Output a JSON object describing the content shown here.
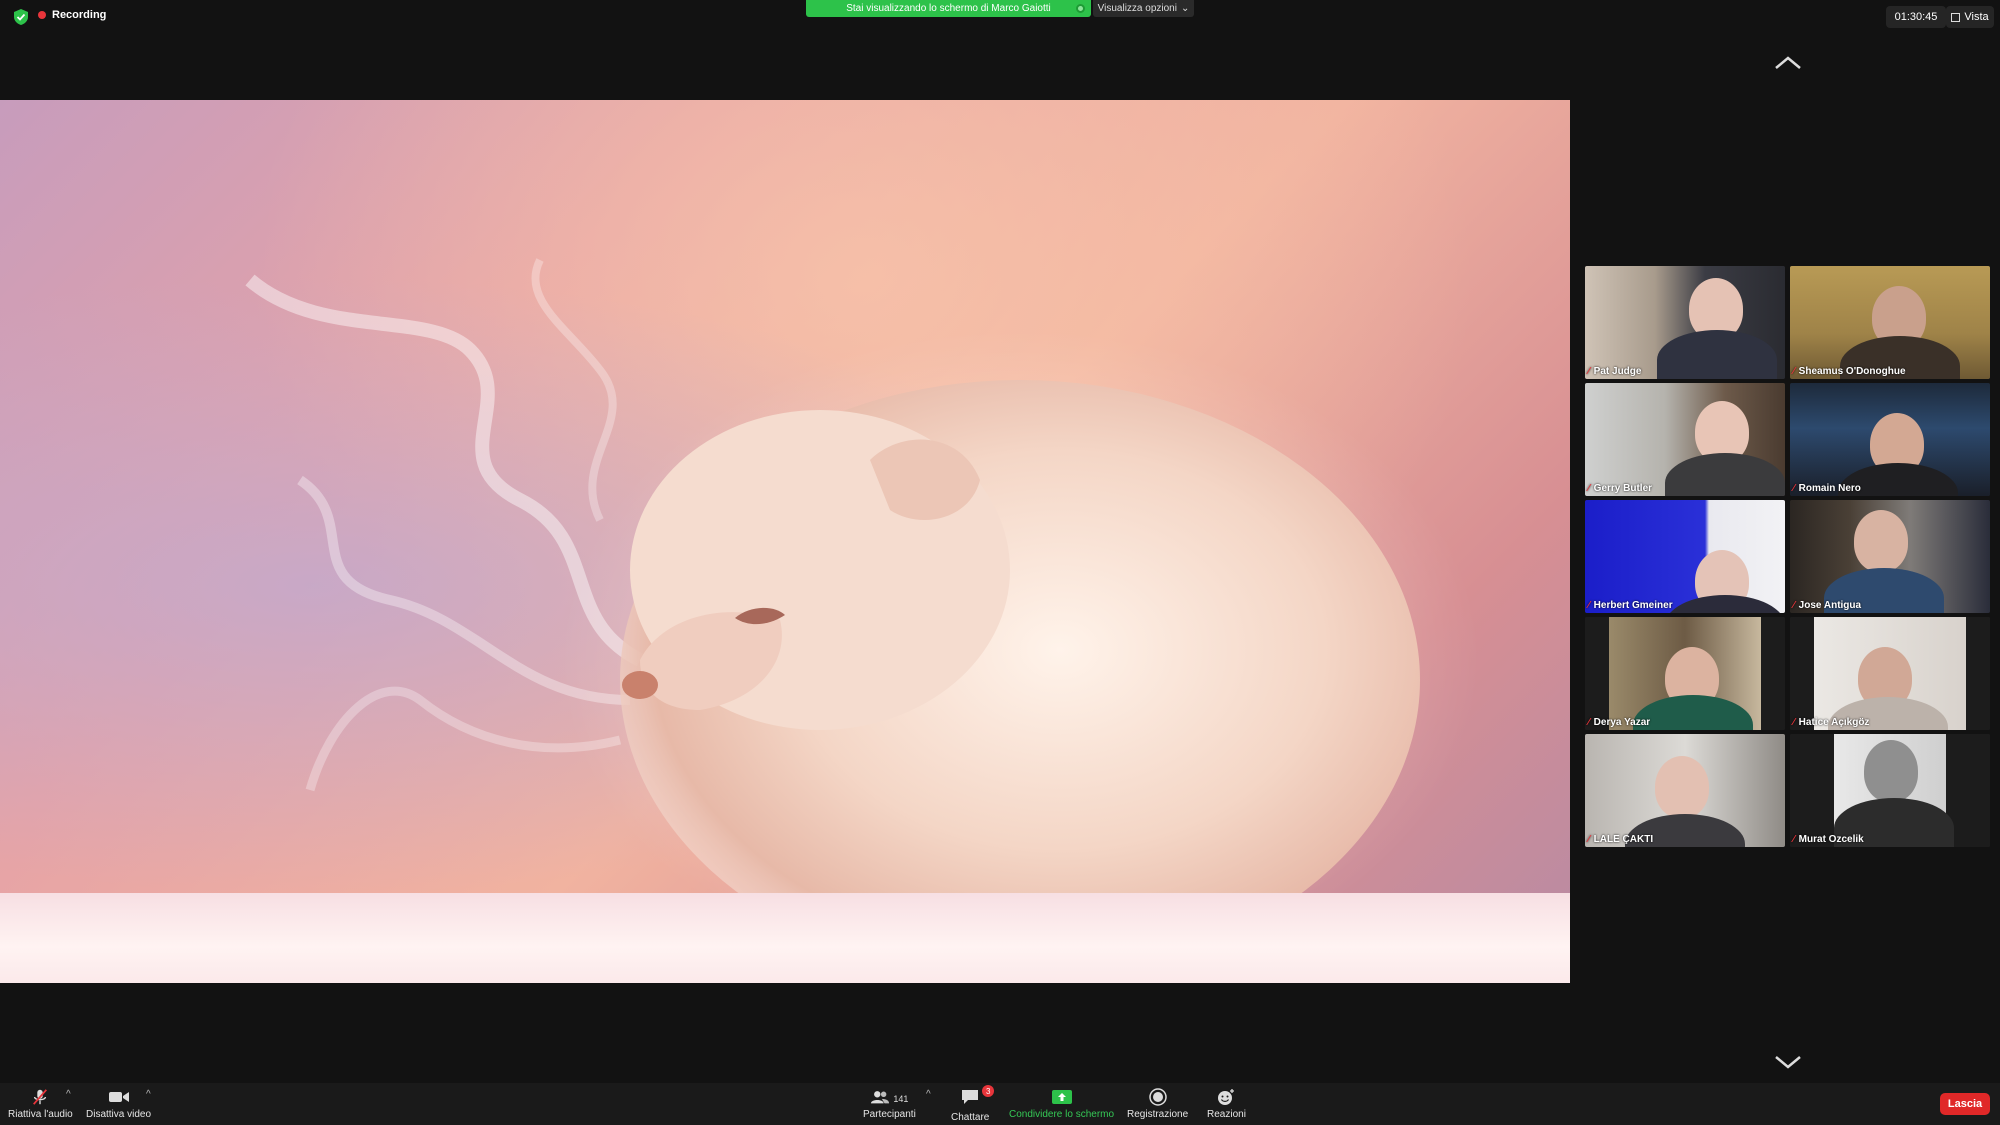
{
  "top": {
    "recording_label": "Recording",
    "share_banner": "Stai visualizzando lo schermo di Marco Gaiotti",
    "view_options": "Visualizza opzioni",
    "timer": "01:30:45",
    "view_label": "Vista"
  },
  "colors": {
    "accent_green": "#2dc24a",
    "recording_red": "#e8353b",
    "leave_red": "#e02828",
    "background": "#121212"
  },
  "participants": [
    {
      "name": "Pat Judge"
    },
    {
      "name": "Sheamus O'Donoghue"
    },
    {
      "name": "Gerry Butler"
    },
    {
      "name": "Romain Nero"
    },
    {
      "name": "Herbert Gmeiner"
    },
    {
      "name": "Jose Antigua"
    },
    {
      "name": "Derya Yazar"
    },
    {
      "name": "Hatice Açıkgöz"
    },
    {
      "name": "LALE ÇAKTI"
    },
    {
      "name": "Murat Ozcelik"
    }
  ],
  "toolbar": {
    "audio": "Riattiva l'audio",
    "video": "Disattiva video",
    "participants": "Partecipanti",
    "participants_count": "141",
    "chat": "Chattare",
    "chat_badge": "3",
    "share": "Condividere lo schermo",
    "record": "Registrazione",
    "reactions": "Reazioni",
    "leave": "Lascia"
  }
}
